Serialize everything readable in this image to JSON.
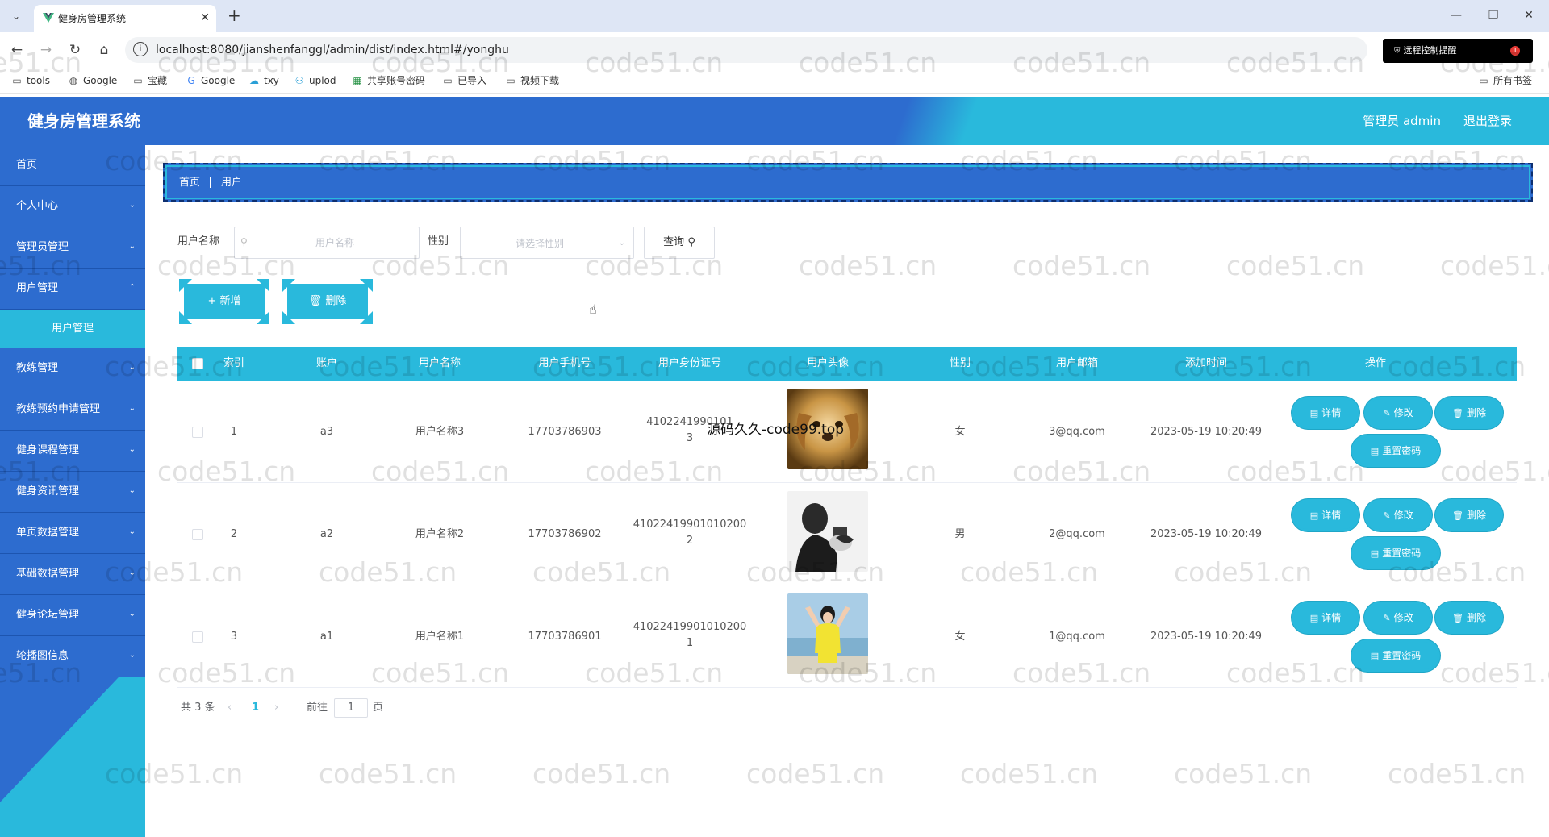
{
  "browser": {
    "tab_title": "健身房管理系统",
    "url": "localhost:8080/jianshenfanggl/admin/dist/index.html#/yonghu",
    "remote_label": "远程控制提醒",
    "remote_badge": "1",
    "bookmarks": [
      "tools",
      "Google",
      "宝藏",
      "Google",
      "txy",
      "uplod",
      "共享账号密码",
      "已导入",
      "视频下载"
    ],
    "all_bookmarks": "所有书签"
  },
  "header": {
    "title": "健身房管理系统",
    "admin": "管理员 admin",
    "logout": "退出登录"
  },
  "sidebar": {
    "items": [
      {
        "label": "首页"
      },
      {
        "label": "个人中心"
      },
      {
        "label": "管理员管理"
      },
      {
        "label": "用户管理"
      },
      {
        "label": "用户管理"
      },
      {
        "label": "教练管理"
      },
      {
        "label": "教练预约申请管理"
      },
      {
        "label": "健身课程管理"
      },
      {
        "label": "健身资讯管理"
      },
      {
        "label": "单页数据管理"
      },
      {
        "label": "基础数据管理"
      },
      {
        "label": "健身论坛管理"
      },
      {
        "label": "轮播图信息"
      }
    ]
  },
  "breadcrumb": {
    "home": "首页",
    "current": "用户"
  },
  "search": {
    "name_label": "用户名称",
    "name_placeholder": "用户名称",
    "gender_label": "性别",
    "gender_placeholder": "请选择性别",
    "query": "查询"
  },
  "actions": {
    "add": "新增",
    "delete": "删除"
  },
  "table": {
    "headers": [
      "索引",
      "账户",
      "用户名称",
      "用户手机号",
      "用户身份证号",
      "用户头像",
      "性别",
      "用户邮箱",
      "添加时间",
      "操作"
    ],
    "rows": [
      {
        "index": "1",
        "account": "a3",
        "name": "用户名称3",
        "phone": "17703786903",
        "id_line1": "4102241990101",
        "id_line2": "3",
        "gender": "女",
        "email": "3@qq.com",
        "time": "2023-05-19 10:20:49"
      },
      {
        "index": "2",
        "account": "a2",
        "name": "用户名称2",
        "phone": "17703786902",
        "id_line1": "41022419901010200",
        "id_line2": "2",
        "gender": "男",
        "email": "2@qq.com",
        "time": "2023-05-19 10:20:49"
      },
      {
        "index": "3",
        "account": "a1",
        "name": "用户名称1",
        "phone": "17703786901",
        "id_line1": "41022419901010200",
        "id_line2": "1",
        "gender": "女",
        "email": "1@qq.com",
        "time": "2023-05-19 10:20:49"
      }
    ],
    "op_detail": "详情",
    "op_edit": "修改",
    "op_delete": "删除",
    "op_reset": "重置密码"
  },
  "pagination": {
    "total": "共 3 条",
    "current": "1",
    "goto": "前往",
    "page_value": "1",
    "page_unit": "页"
  },
  "overlay": "源码久久-code99.top",
  "watermark": "code51.cn",
  "colors": {
    "primary_blue": "#2d6ccf",
    "accent_cyan": "#29b9dc"
  }
}
